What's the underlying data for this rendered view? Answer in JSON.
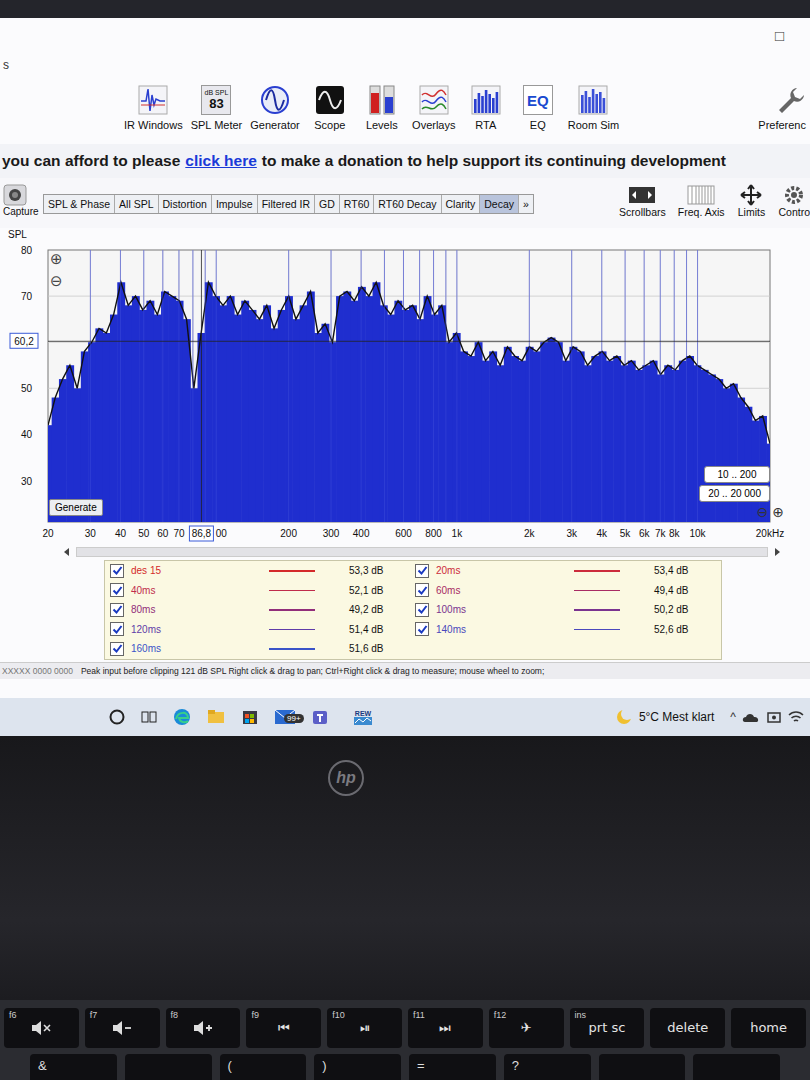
{
  "window": {
    "title_fragment": "s",
    "maximize": "□"
  },
  "toolbar": [
    {
      "label": "IR Windows",
      "kind": "ir"
    },
    {
      "label": "SPL Meter",
      "kind": "spl",
      "unit": "dB SPL",
      "value": "83"
    },
    {
      "label": "Generator",
      "kind": "generator"
    },
    {
      "label": "Scope",
      "kind": "scope"
    },
    {
      "label": "Levels",
      "kind": "levels"
    },
    {
      "label": "Overlays",
      "kind": "overlays"
    },
    {
      "label": "RTA",
      "kind": "rta"
    },
    {
      "label": "EQ",
      "kind": "eq",
      "icon_text": "EQ"
    },
    {
      "label": "Room Sim",
      "kind": "roomsim"
    },
    {
      "label": "Preferenc",
      "kind": "prefs"
    }
  ],
  "donation": {
    "before": "you can afford to please",
    "link": "click here",
    "after": "to make a donation to help support its continuing development"
  },
  "capture": "Capture",
  "tabs": [
    {
      "label": "SPL & Phase",
      "selected": false
    },
    {
      "label": "All SPL",
      "selected": false
    },
    {
      "label": "Distortion",
      "selected": false
    },
    {
      "label": "Impulse",
      "selected": false
    },
    {
      "label": "Filtered IR",
      "selected": false
    },
    {
      "label": "GD",
      "selected": false
    },
    {
      "label": "RT60",
      "selected": false
    },
    {
      "label": "RT60 Decay",
      "selected": false
    },
    {
      "label": "Clarity",
      "selected": false
    },
    {
      "label": "Decay",
      "selected": true
    },
    {
      "label": "»",
      "selected": false
    }
  ],
  "view_tools": [
    {
      "label": "Scrollbars",
      "kind": "scrollbars"
    },
    {
      "label": "Freq. Axis",
      "kind": "freq"
    },
    {
      "label": "Limits",
      "kind": "limits"
    },
    {
      "label": "Contro",
      "kind": "controls"
    }
  ],
  "chart": {
    "y_label": "SPL",
    "y_min": 21,
    "y_max": 80,
    "y_ticks": [
      {
        "label": "80",
        "db": 80
      },
      {
        "label": "70",
        "db": 70
      },
      {
        "label": "50",
        "db": 50
      },
      {
        "label": "40",
        "db": 40
      },
      {
        "label": "30",
        "db": 30
      }
    ],
    "y_cursor": {
      "label": "60,2",
      "db": 60.2
    },
    "x_cursor": {
      "label": "86,8",
      "hz": 86.8
    },
    "x_ticks": [
      {
        "label": "20",
        "hz": 20
      },
      {
        "label": "30",
        "hz": 30
      },
      {
        "label": "40",
        "hz": 40
      },
      {
        "label": "50",
        "hz": 50
      },
      {
        "label": "60",
        "hz": 60
      },
      {
        "label": "70",
        "hz": 70
      },
      {
        "label": "00",
        "hz": 100
      },
      {
        "label": "200",
        "hz": 200
      },
      {
        "label": "300",
        "hz": 300
      },
      {
        "label": "400",
        "hz": 400
      },
      {
        "label": "600",
        "hz": 600
      },
      {
        "label": "800",
        "hz": 800
      },
      {
        "label": "1k",
        "hz": 1000
      },
      {
        "label": "2k",
        "hz": 2000
      },
      {
        "label": "3k",
        "hz": 3000
      },
      {
        "label": "4k",
        "hz": 4000
      },
      {
        "label": "5k",
        "hz": 5000
      },
      {
        "label": "6k",
        "hz": 6000
      },
      {
        "label": "7k",
        "hz": 7000
      },
      {
        "label": "8k",
        "hz": 8000
      },
      {
        "label": "10k",
        "hz": 10000
      },
      {
        "label": "20kHz",
        "hz": 20000
      }
    ],
    "zoom_in": "⊕",
    "zoom_out": "⊖",
    "generate": "Generate",
    "range_buttons": [
      "10 .. 200",
      "20 .. 20 000"
    ],
    "series": [
      {
        "name": "des 15",
        "values": [
          42,
          48,
          52,
          55,
          50,
          58,
          60,
          63,
          62,
          66,
          73,
          68,
          70,
          67,
          69,
          66,
          71,
          70,
          69,
          65,
          50,
          62,
          73,
          70,
          68,
          70,
          66,
          69,
          67,
          65,
          68,
          63,
          67,
          70,
          65,
          68,
          71,
          62,
          64,
          60,
          70,
          71,
          69,
          72,
          70,
          73,
          68,
          66,
          69,
          67,
          68,
          65,
          70,
          66,
          68,
          60,
          62,
          58,
          57,
          60,
          56,
          58,
          55,
          59,
          57,
          56,
          59,
          58,
          60,
          61,
          60,
          56,
          59,
          58,
          55,
          57,
          58,
          56,
          57,
          55,
          56,
          54,
          55,
          56,
          53,
          55,
          54,
          56,
          57,
          55,
          54,
          53,
          52,
          50,
          51,
          48,
          46,
          43,
          44,
          38
        ]
      }
    ]
  },
  "legend": [
    {
      "label": "des 15",
      "value": "53,3 dB",
      "checked": true,
      "color": "#d42a2a"
    },
    {
      "label": "20ms",
      "value": "53,4 dB",
      "checked": true,
      "color": "#cc2c3c"
    },
    {
      "label": "40ms",
      "value": "52,1 dB",
      "checked": true,
      "color": "#c02c4c"
    },
    {
      "label": "60ms",
      "value": "49,4 dB",
      "checked": true,
      "color": "#a82c64"
    },
    {
      "label": "80ms",
      "value": "49,2 dB",
      "checked": true,
      "color": "#922e7a"
    },
    {
      "label": "100ms",
      "value": "50,2 dB",
      "checked": true,
      "color": "#7a3490"
    },
    {
      "label": "120ms",
      "value": "51,4 dB",
      "checked": true,
      "color": "#5f3ca8"
    },
    {
      "label": "140ms",
      "value": "52,6 dB",
      "checked": true,
      "color": "#4a48bc"
    },
    {
      "label": "160ms",
      "value": "51,6 dB",
      "checked": true,
      "color": "#3a54c8"
    }
  ],
  "status": {
    "left": "XXXXX 0000 0000",
    "text": "Peak input before clipping 121 dB SPL   Right click & drag to pan; Ctrl+Right click & drag to measure; mouse wheel to zoom;"
  },
  "taskbar": {
    "mail_badge": "99+",
    "rew_label": "REW",
    "weather": "5°C Mest klart",
    "chevron": "^"
  },
  "laptop": {
    "logo": "hp"
  },
  "keys": [
    {
      "fn": "f6",
      "kind": "mute",
      "glyph": ""
    },
    {
      "fn": "f7",
      "kind": "vol-down",
      "glyph": ""
    },
    {
      "fn": "f8",
      "kind": "vol-up",
      "glyph": ""
    },
    {
      "fn": "f9",
      "kind": "glyph",
      "glyph": "⏮"
    },
    {
      "fn": "f10",
      "kind": "glyph",
      "glyph": "⏯"
    },
    {
      "fn": "f11",
      "kind": "glyph",
      "glyph": "⏭"
    },
    {
      "fn": "f12",
      "kind": "glyph",
      "glyph": "✈"
    },
    {
      "fn": "ins",
      "kind": "glyph",
      "glyph": "prt sc"
    },
    {
      "fn": "",
      "kind": "glyph",
      "glyph": "delete"
    },
    {
      "fn": "",
      "kind": "glyph",
      "glyph": "home"
    }
  ],
  "bottom_keys": [
    "&",
    "",
    "(",
    ")",
    "=",
    "?",
    "",
    ""
  ]
}
